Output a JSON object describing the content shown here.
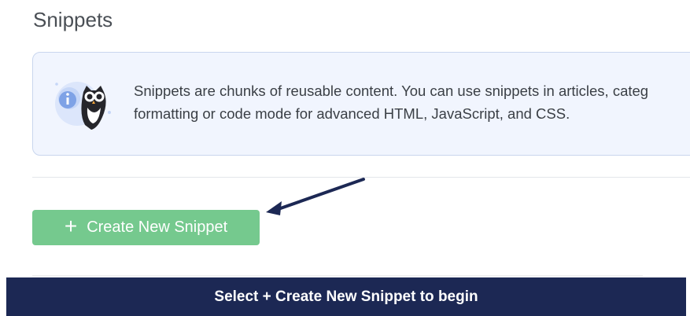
{
  "page": {
    "title": "Snippets"
  },
  "info": {
    "text": "Snippets are chunks of reusable content. You can use snippets in articles, categ\nformatting or code mode for advanced HTML, JavaScript, and CSS.",
    "icon": "owl-info-icon"
  },
  "actions": {
    "create_label": "Create New Snippet",
    "create_icon": "plus-icon"
  },
  "banner": {
    "text": "Select + Create New Snippet to begin"
  },
  "colors": {
    "primary_button": "#75c98e",
    "banner_bg": "#1c2854",
    "info_bg": "#f1f5fe",
    "arrow": "#1c2854"
  }
}
